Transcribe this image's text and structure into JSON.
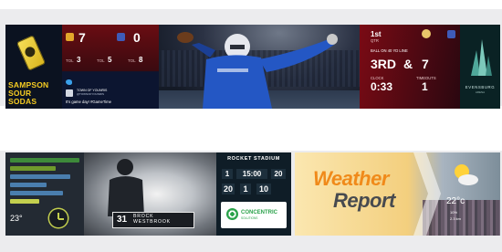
{
  "banner_top": {
    "sponsor": {
      "name": "SAMPSON SOUR SODAS"
    },
    "score": {
      "home_score": "7",
      "away_score": "0",
      "stats": [
        {
          "label": "TOL",
          "value": "3"
        },
        {
          "label": "TOL",
          "value": "5"
        },
        {
          "label": "TOL",
          "value": "8"
        }
      ]
    },
    "tweet": {
      "handle": "TOWN OF YOUNRIS",
      "sub": "@TOWNOFYOUNRIS",
      "text": "It's game day! #GameTime"
    },
    "game": {
      "down_label": "BALL ON 40 YD LINE",
      "down": "3RD",
      "amp": "&",
      "distance": "7",
      "clock": "0:33",
      "clock_label": "CLOCK",
      "timeouts": "1",
      "timeouts_label": "TIMEOUTS",
      "quarter": "1st",
      "quarter_label": "QTR"
    },
    "arena": {
      "name": "EVENSBURG",
      "sub": "ARENA"
    }
  },
  "banner_bottom_left": {
    "temperature": "23°",
    "player": {
      "number": "31",
      "first": "BROCK",
      "last": "WESTBROOK"
    },
    "stadium": {
      "name": "ROCKET STADIUM",
      "period": "1",
      "clock": "15:00",
      "home": "20",
      "down": "1",
      "distance": "10",
      "away": "20"
    },
    "sponsor": {
      "name": "CONCENTRIC",
      "sub": "SOLUTIONS"
    }
  },
  "banner_bottom_right": {
    "title_1": "Weather",
    "title_2": "Report",
    "temp_now": "22°c",
    "details": [
      "10%",
      "2.3 km"
    ]
  },
  "colors": {
    "page_bg": "#ececee",
    "sponsor_yellow": "#f6cc22",
    "team_red": "#6a0d12",
    "twitter_blue": "#3aa0ea",
    "weather_orange": "#f08a1a",
    "concentric_green": "#2aa24a"
  }
}
